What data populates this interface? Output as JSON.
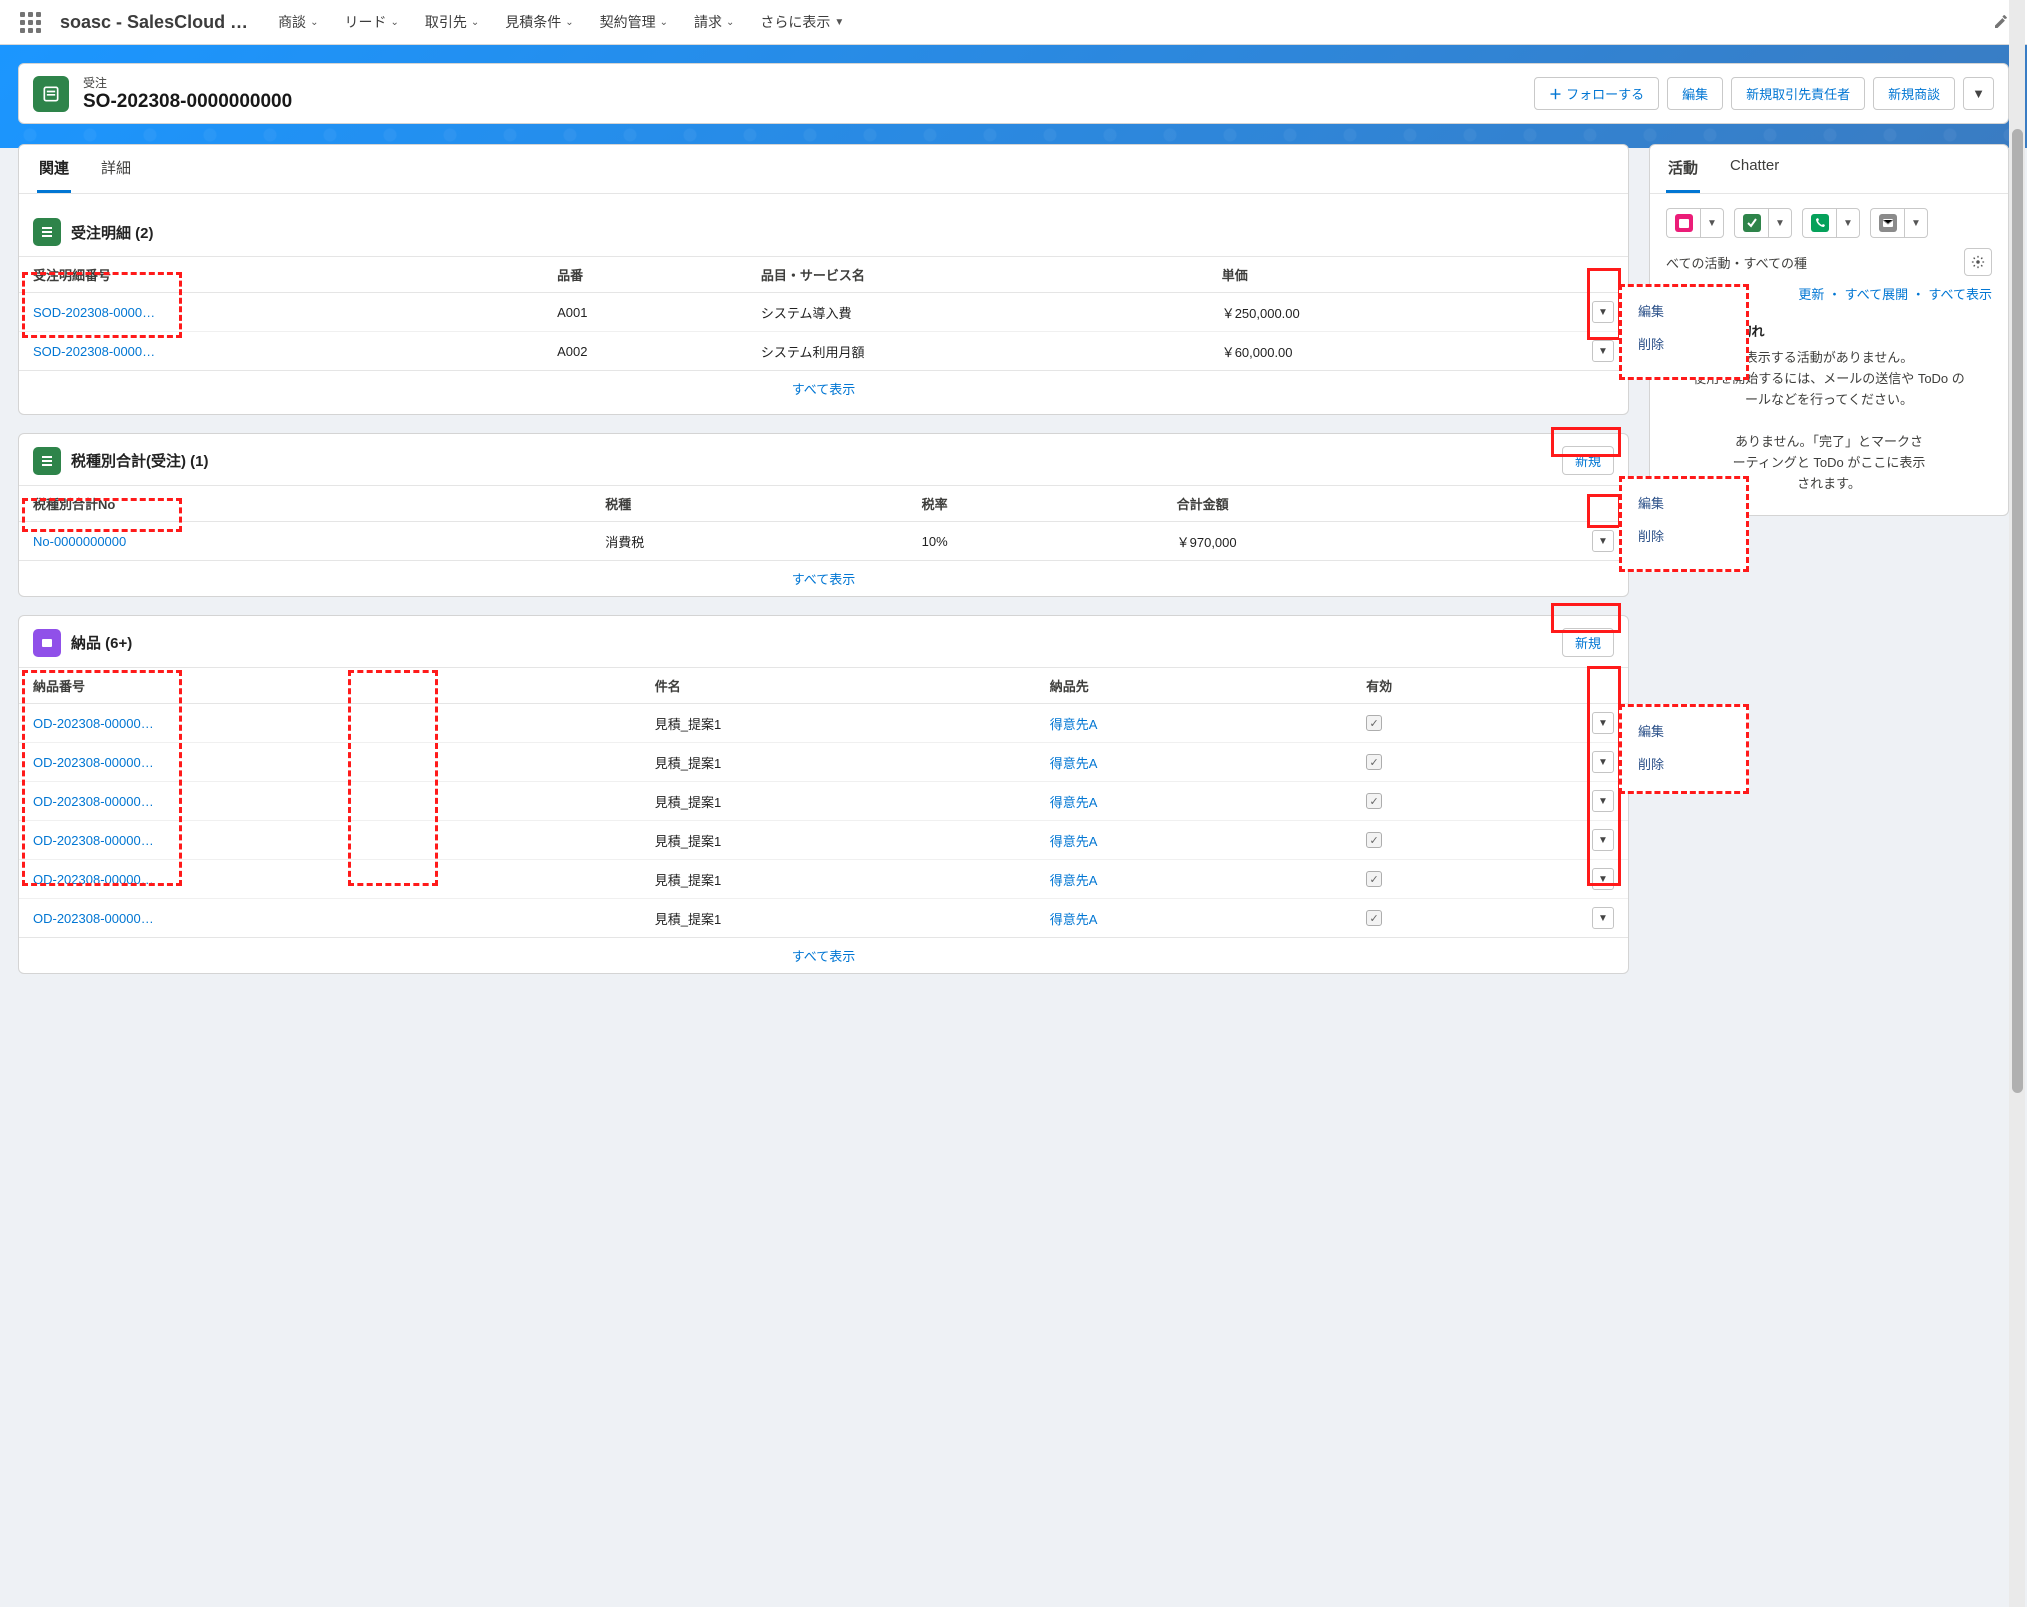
{
  "app": {
    "name": "soasc - SalesCloud …"
  },
  "nav": [
    "商談",
    "リード",
    "取引先",
    "見積条件",
    "契約管理",
    "請求",
    "さらに表示"
  ],
  "record": {
    "object_label": "受注",
    "title": "SO-202308-0000000000",
    "follow": "フォローする",
    "actions": [
      "編集",
      "新規取引先責任者",
      "新規商談"
    ]
  },
  "tabs": {
    "related": "関連",
    "detail": "詳細"
  },
  "related": {
    "order_detail": {
      "title": "受注明細 (2)",
      "view_all": "すべて表示",
      "cols": [
        "受注明細番号",
        "品番",
        "品目・サービス名",
        "単価"
      ],
      "rows": [
        {
          "link": "SOD-202308-0000…",
          "code": "A001",
          "name": "システム導入費",
          "price": "￥250,000.00"
        },
        {
          "link": "SOD-202308-0000…",
          "code": "A002",
          "name": "システム利用月額",
          "price": "￥60,000.00"
        }
      ]
    },
    "tax_total": {
      "title": "税種別合計(受注) (1)",
      "new": "新規",
      "view_all": "すべて表示",
      "cols": [
        "税種別合計No",
        "税種",
        "税率",
        "合計金額"
      ],
      "rows": [
        {
          "link": "No-0000000000",
          "kind": "消費税",
          "rate": "10%",
          "amount": "￥970,000"
        }
      ]
    },
    "delivery": {
      "title": "納品 (6+)",
      "new": "新規",
      "view_all": "すべて表示",
      "cols": [
        "納品番号",
        "件名",
        "納品先",
        "有効"
      ],
      "rows": [
        {
          "link": "OD-202308-00000…",
          "subject": "見積_提案1",
          "dest": "得意先A"
        },
        {
          "link": "OD-202308-00000…",
          "subject": "見積_提案1",
          "dest": "得意先A"
        },
        {
          "link": "OD-202308-00000…",
          "subject": "見積_提案1",
          "dest": "得意先A"
        },
        {
          "link": "OD-202308-00000…",
          "subject": "見積_提案1",
          "dest": "得意先A"
        },
        {
          "link": "OD-202308-00000…",
          "subject": "見積_提案1",
          "dest": "得意先A"
        },
        {
          "link": "OD-202308-00000…",
          "subject": "見積_提案1",
          "dest": "得意先A"
        }
      ]
    }
  },
  "row_menu": {
    "edit": "編集",
    "delete": "削除"
  },
  "activity": {
    "tabs": {
      "activity": "活動",
      "chatter": "Chatter"
    },
    "filter_text": "べての活動・すべての種",
    "links": {
      "refresh": "更新",
      "expand": "すべて展開",
      "view_all": "すべて表示"
    },
    "section_upcoming": "後 & 期限切れ",
    "empty_upcoming_l1": "表示する活動がありません。",
    "empty_upcoming_l2": "使用を開始するには、メールの送信や ToDo の",
    "empty_upcoming_l3": "ールなどを行ってください。",
    "empty_past_l1": "ありません。「完了」とマークさ",
    "empty_past_l2": "ーティングと ToDo がここに表示",
    "empty_past_l3": "されます。"
  },
  "colors": {
    "event": "#e3066a",
    "task": "#2e844a",
    "call": "#04844b",
    "email": "#939393",
    "call_bg": "#05a15a",
    "event_bg": "#eb1d78",
    "task_bg": "#2e844a",
    "email_bg": "#8b8b8b"
  }
}
